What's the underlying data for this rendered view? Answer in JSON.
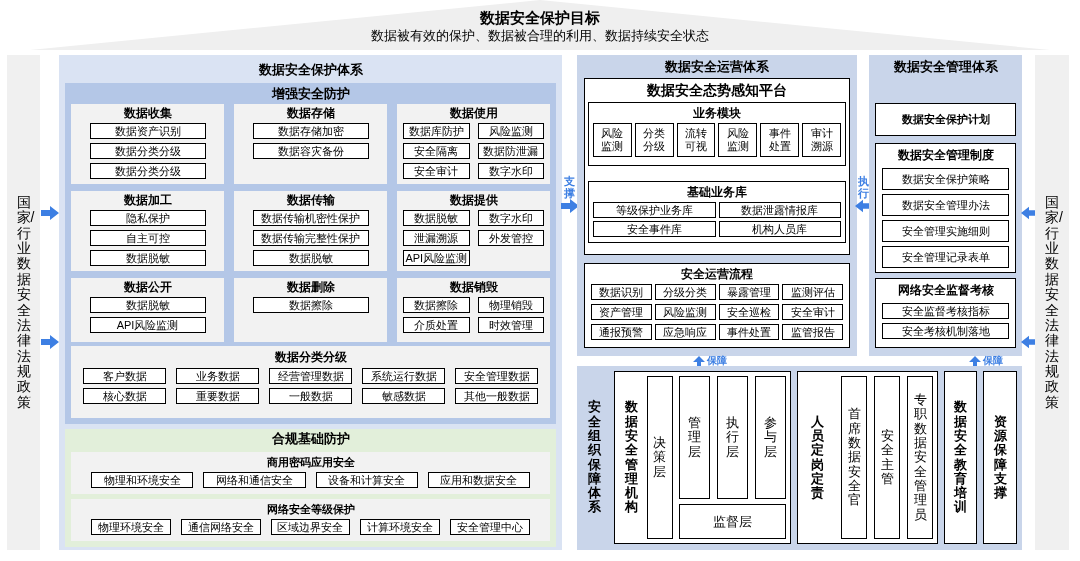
{
  "goal": {
    "title": "数据安全保护目标",
    "subtitle": "数据被有效的保护、数据被合理的利用、数据持续安全状态"
  },
  "policy_sidebars": [
    {
      "text": "国家/行业数据安全法律法规政策"
    },
    {
      "text": "国家/行业数据安全法律法规政策"
    }
  ],
  "protection_system": {
    "title": "数据安全保护体系",
    "enhanced": {
      "title": "增强安全防护",
      "stages": [
        {
          "title": "数据收集",
          "kind": "list",
          "items": [
            "数据资产识别",
            "数据分类分级",
            "数据分类分级"
          ]
        },
        {
          "title": "数据存储",
          "kind": "list",
          "items": [
            "数据存储加密",
            "数据容灾备份"
          ]
        },
        {
          "title": "数据使用",
          "kind": "grid",
          "items": [
            "数据库防护",
            "风险监测",
            "安全隔离",
            "数据防泄漏",
            "安全审计",
            "数字水印"
          ]
        },
        {
          "title": "数据加工",
          "kind": "list",
          "items": [
            "隐私保护",
            "自主可控",
            "数据脱敏"
          ]
        },
        {
          "title": "数据传输",
          "kind": "list",
          "items": [
            "数据传输机密性保护",
            "数据传输完整性保护",
            "数据脱敏"
          ]
        },
        {
          "title": "数据提供",
          "kind": "grid",
          "items": [
            "数据脱敏",
            "数字水印",
            "泄漏溯源",
            "外发管控",
            "API风险监测"
          ]
        },
        {
          "title": "数据公开",
          "kind": "list",
          "items": [
            "数据脱敏",
            "API风险监测"
          ]
        },
        {
          "title": "数据删除",
          "kind": "list",
          "items": [
            "数据擦除"
          ]
        },
        {
          "title": "数据销毁",
          "kind": "grid",
          "items": [
            "数据擦除",
            "物理销毁",
            "介质处置",
            "时效管理"
          ]
        }
      ],
      "classification": {
        "title": "数据分类分级",
        "items": [
          "客户数据",
          "业务数据",
          "经营管理数据",
          "系统运行数据",
          "安全管理数据",
          "核心数据",
          "重要数据",
          "一般数据",
          "敏感数据",
          "其他一般数据"
        ]
      }
    },
    "compliance": {
      "title": "合规基础防护",
      "groups": [
        {
          "title": "商用密码应用安全",
          "items": [
            "物理和环境安全",
            "网络和通信安全",
            "设备和计算安全",
            "应用和数据安全"
          ]
        },
        {
          "title": "网络安全等级保护",
          "items": [
            "物理环境安全",
            "通信网络安全",
            "区域边界安全",
            "计算环境安全",
            "安全管理中心"
          ]
        }
      ]
    }
  },
  "connectors": {
    "support": "支撑",
    "execute": "执行",
    "guarantee": [
      "保障",
      "保障"
    ]
  },
  "operations_system": {
    "title": "数据安全运营体系",
    "platform": {
      "title": "数据安全态势感知平台",
      "modules": {
        "title": "业务模块",
        "items": [
          "风险监测",
          "分类分级",
          "流转可视",
          "风险监测",
          "事件处置",
          "审计溯源"
        ]
      },
      "libraries": {
        "title": "基础业务库",
        "items": [
          "等级保护业务库",
          "数据泄露情报库",
          "安全事件库",
          "机构人员库"
        ]
      }
    },
    "process": {
      "title": "安全运营流程",
      "items": [
        "数据识别",
        "分级分类",
        "暴露管理",
        "监测评估",
        "资产管理",
        "风险监测",
        "安全巡检",
        "安全审计",
        "通报预警",
        "应急响应",
        "事件处置",
        "监管报告"
      ]
    }
  },
  "management_system": {
    "title": "数据安全管理体系",
    "plan": "数据安全保护计划",
    "policies": {
      "title": "数据安全管理制度",
      "items": [
        "数据安全保护策略",
        "数据安全管理办法",
        "安全管理实施细则",
        "安全管理记录表单"
      ]
    },
    "supervision": {
      "title": "网络安全监督考核",
      "items": [
        "安全监督考核指标",
        "安全考核机制落地"
      ]
    }
  },
  "organization": {
    "title": "安全组织保障体系",
    "institution": {
      "title": "数据安全管理机构",
      "decision": "决策层",
      "layers": [
        "管理层",
        "执行层",
        "参与层"
      ],
      "supervision": "监督层"
    },
    "roles": {
      "title": "人员定岗定责",
      "items": [
        "首席数据安全官",
        "安全主管",
        "专职数据安全管理员"
      ]
    },
    "training": "数据安全教育培训",
    "resources": "资源保障支撑"
  }
}
